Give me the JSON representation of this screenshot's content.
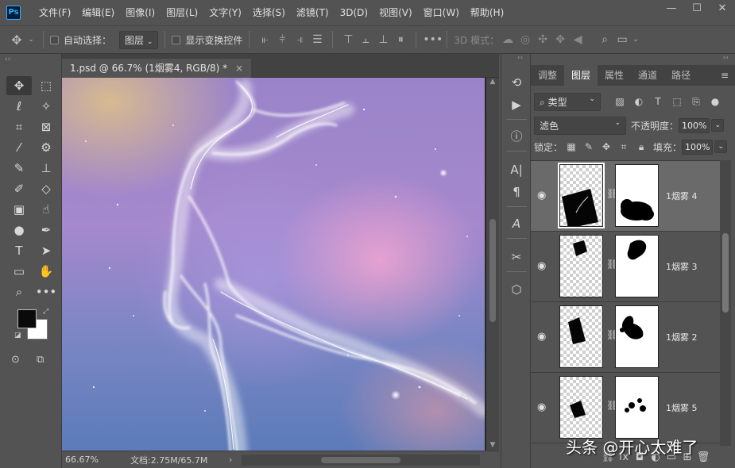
{
  "app": {
    "logo": "Ps"
  },
  "menu": [
    "文件(F)",
    "编辑(E)",
    "图像(I)",
    "图层(L)",
    "文字(Y)",
    "选择(S)",
    "滤镜(T)",
    "3D(D)",
    "视图(V)",
    "窗口(W)",
    "帮助(H)"
  ],
  "window": {
    "minimize": "—",
    "maximize": "☐",
    "close": "✕"
  },
  "options": {
    "move_tool_icon": "move-icon",
    "auto_select_label": "自动选择：",
    "auto_select_target": "图层",
    "show_transform_label": "显示变换控件",
    "mode_3d_label": "3D 模式：",
    "more": "•••"
  },
  "document": {
    "tab_title": "1.psd @ 66.7% (1烟雾4, RGB/8) *",
    "close": "×"
  },
  "status": {
    "zoom": "66.67%",
    "doc_size": "文档:2.75M/65.7M",
    "arrow": "›"
  },
  "toolbox": {
    "collapse": "‹‹"
  },
  "panels": {
    "collapse_left": "‹‹",
    "collapse_right": "››",
    "tabs": [
      "调整",
      "图层",
      "属性",
      "通道",
      "路径"
    ],
    "active_tab": "图层",
    "menu": "≡",
    "filter_kind": "类型",
    "blend_mode": "滤色",
    "opacity_label": "不透明度：",
    "opacity_value": "100%",
    "lock_label": "锁定：",
    "fill_label": "填充：",
    "fill_value": "100%"
  },
  "layers": [
    {
      "name": "1烟雾 4",
      "selected": true
    },
    {
      "name": "1烟雾 3",
      "selected": false
    },
    {
      "name": "1烟雾 2",
      "selected": false
    },
    {
      "name": "1烟雾 5",
      "selected": false
    }
  ],
  "watermark": "头条 @开心太难了"
}
